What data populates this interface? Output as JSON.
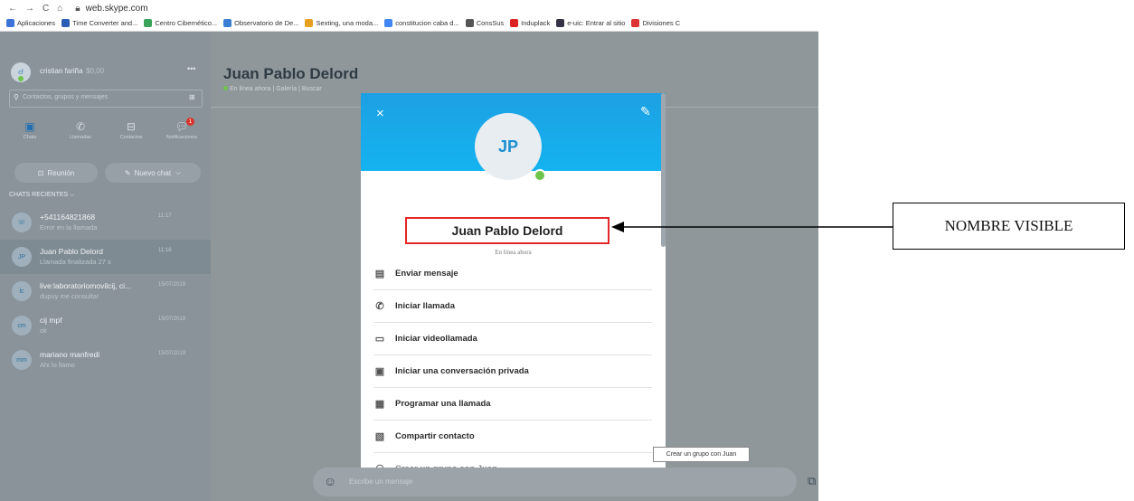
{
  "browser": {
    "url": "web.skype.com",
    "bookmarks": [
      {
        "label": "Aplicaciones",
        "color": "#3b73d9"
      },
      {
        "label": "Time Converter and...",
        "color": "#2a5fb5"
      },
      {
        "label": "Centro Cibernético...",
        "color": "#3aa35a"
      },
      {
        "label": "Observatorio de De...",
        "color": "#3a7fd5"
      },
      {
        "label": "Sexting, una moda...",
        "color": "#e8a020"
      },
      {
        "label": "constitucion caba d...",
        "color": "#4285f4"
      },
      {
        "label": "ConsSus",
        "color": "#555555"
      },
      {
        "label": "Induplack",
        "color": "#d22"
      },
      {
        "label": "e-uic: Entrar al sitio",
        "color": "#334"
      },
      {
        "label": "Divisiones C",
        "color": "#d33"
      }
    ]
  },
  "profile": {
    "initials": "cf",
    "name": "cristian fariña",
    "credit": "$0,00",
    "more": "•••"
  },
  "search": {
    "placeholder": "Contactos, grupos y mensajes"
  },
  "nav": [
    {
      "label": "Chats"
    },
    {
      "label": "Llamadas"
    },
    {
      "label": "Contactos"
    },
    {
      "label": "Notificaciones",
      "badge": "1"
    }
  ],
  "buttons": {
    "meeting": "Reunión",
    "new_chat": "Nuevo chat"
  },
  "recent_header": "CHATS RECIENTES",
  "chats": [
    {
      "initials": "☏",
      "name": "+541164821868",
      "preview": "Error en la llamada",
      "time": "11:17"
    },
    {
      "initials": "JP",
      "name": "Juan Pablo Delord",
      "preview": "Llamada finalizada 27 s",
      "time": "11:16"
    },
    {
      "initials": "lc",
      "name": "live:laboratoriomovilcij, ci...",
      "preview": "dupuy me consulta!",
      "time": "15/07/2019"
    },
    {
      "initials": "cm",
      "name": "cij mpf",
      "preview": "ok",
      "time": "15/07/2019"
    },
    {
      "initials": "mm",
      "name": "mariano manfredi",
      "preview": "Ahi lo llamo",
      "time": "15/07/2019"
    }
  ],
  "chat_header": {
    "title": "Juan Pablo Delord",
    "subtitle": "En línea ahora | Galería | Buscar"
  },
  "modal": {
    "initials": "JP",
    "name": "Juan Pablo Delord",
    "status": "En línea ahora",
    "actions": [
      {
        "label": "Enviar mensaje",
        "icon": "message-icon"
      },
      {
        "label": "Iniciar llamada",
        "icon": "phone-icon"
      },
      {
        "label": "Iniciar videollamada",
        "icon": "video-icon"
      },
      {
        "label": "Iniciar una conversación privada",
        "icon": "lock-icon"
      },
      {
        "label": "Programar una llamada",
        "icon": "calendar-icon"
      },
      {
        "label": "Compartir contacto",
        "icon": "contact-card-icon"
      },
      {
        "label": "Crear un grupo con Juan",
        "icon": "group-icon"
      }
    ]
  },
  "tooltip": "Crear un grupo con Juan",
  "message_input": {
    "placeholder": "Escribe un mensaje"
  },
  "annotation": {
    "label": "NOMBRE VISIBLE"
  },
  "colors": {
    "highlight_border": "#e3262a",
    "skype_blue": "#1da0e3",
    "online": "#6ec54a"
  }
}
